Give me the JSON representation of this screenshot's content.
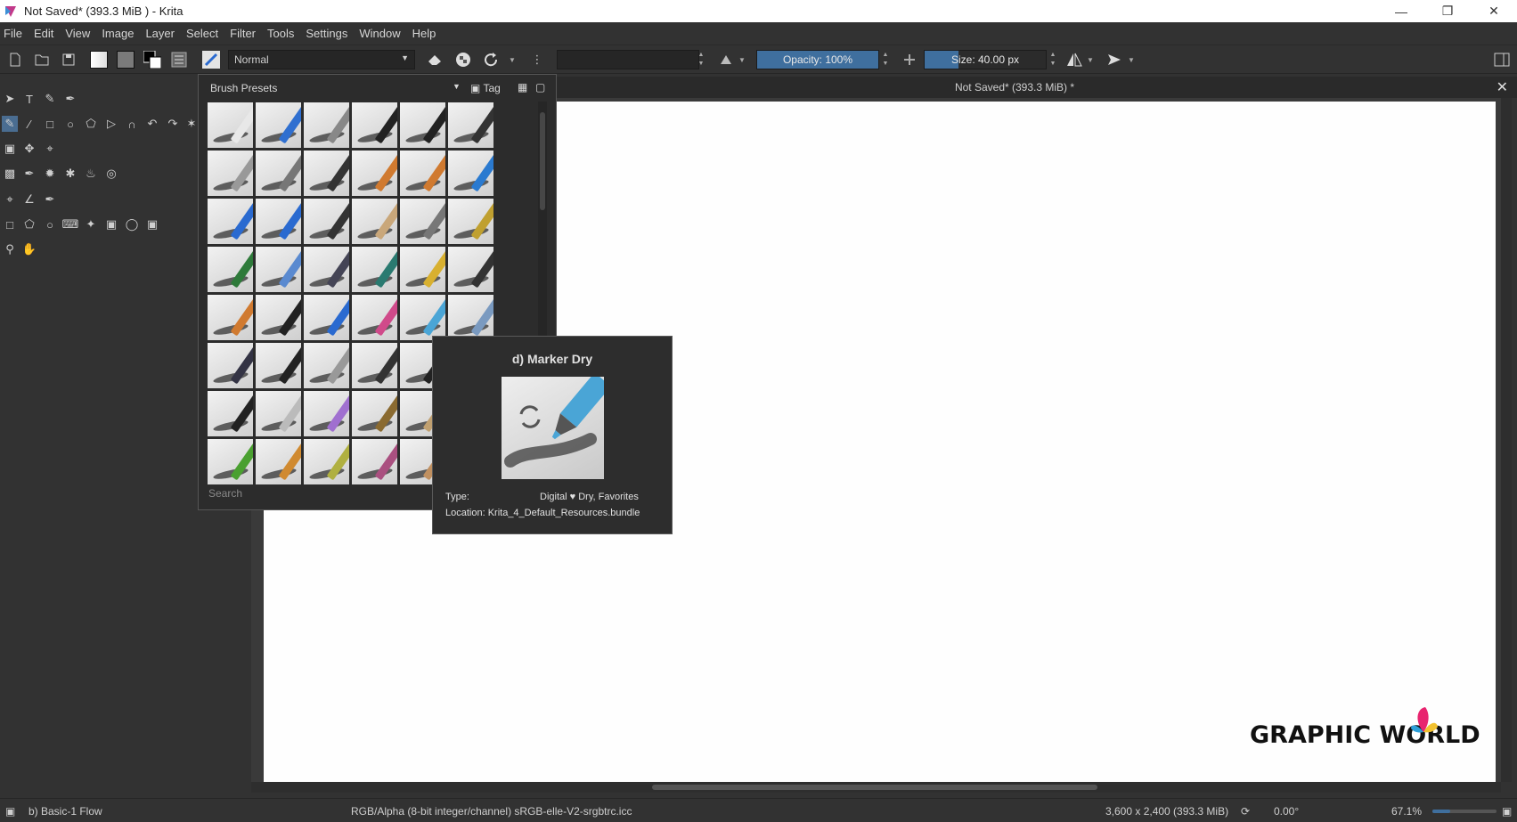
{
  "window": {
    "title": "Not Saved*  (393.3 MiB )  - Krita",
    "controls": [
      "minimize",
      "restore",
      "close"
    ]
  },
  "menubar": [
    "File",
    "Edit",
    "View",
    "Image",
    "Layer",
    "Select",
    "Filter",
    "Tools",
    "Settings",
    "Window",
    "Help"
  ],
  "toolbar": {
    "blend_mode": "Normal",
    "opacity_label": "Opacity: 100%",
    "opacity_value": 100,
    "size_label": "Size: 40.00 px",
    "size_value": 40,
    "accent": "#3f6f9e"
  },
  "document": {
    "tab_title": "Not Saved*  (393.3 MiB)  *",
    "canvas_color": "#fefefe"
  },
  "brush_presets": {
    "title": "Brush Presets",
    "tag_label": "Tag",
    "search_placeholder": "Search"
  },
  "tooltip": {
    "name": "d) Marker Dry",
    "type_label": "Type:",
    "type_value": "Digital  ♥ Dry, Favorites",
    "location": "Location: Krita_4_Default_Resources.bundle"
  },
  "logo": {
    "text": "GRAPHIC WORLD"
  },
  "statusbar": {
    "brush": "b) Basic-1 Flow",
    "color_info": "RGB/Alpha (8-bit integer/channel)  sRGB-elle-V2-srgbtrc.icc",
    "dimensions": "3,600 x 2,400 (393.3 MiB)",
    "rotation": "0.00°",
    "zoom": "67.1%"
  }
}
